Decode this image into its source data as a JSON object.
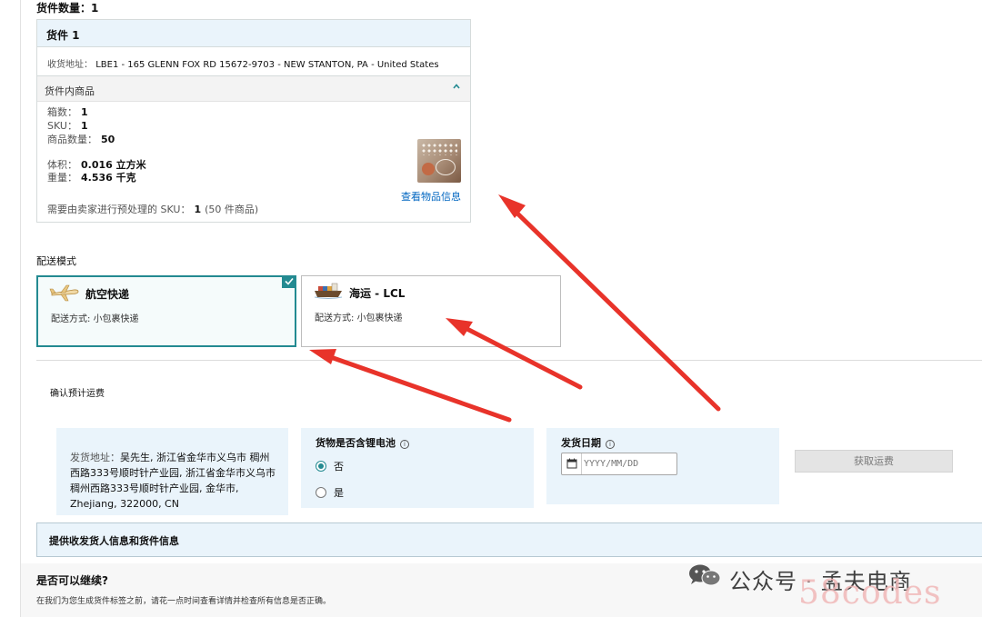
{
  "shipment_count": "货件数量：1",
  "shipment": {
    "title": "货件 1",
    "ship_to_label": "收货地址：",
    "ship_to_value": "LBE1 - 165 GLENN FOX RD 15672-9703 - NEW STANTON, PA - United States",
    "items_header": "货件内商品",
    "boxes_label": "箱数：",
    "boxes_value": "1",
    "sku_label": "SKU：",
    "sku_value": "1",
    "units_label": "商品数量：",
    "units_value": "50",
    "volume_label": "体积：",
    "volume_value": "0.016 立方米",
    "weight_label": "重量：",
    "weight_value": "4.536 千克",
    "view_item_link": "查看物品信息",
    "prep_note_prefix": "需要由卖家进行预处理的 SKU：",
    "prep_note_count": "1",
    "prep_note_suffix": "(50 件商品)"
  },
  "shipping_mode": {
    "title": "配送模式",
    "options": [
      {
        "title": "航空快递",
        "sub_label": "配送方式:",
        "sub_value": "小包裹快递",
        "selected": true
      },
      {
        "title": "海运 - LCL",
        "sub_label": "配送方式:",
        "sub_value": "小包裹快递",
        "selected": false
      }
    ]
  },
  "confirm_fee": {
    "title": "确认预计运费",
    "from_label": "发货地址：",
    "from_value": "吴先生, 浙江省金华市义乌市 稠州西路333号顺时针产业园, 浙江省金华市义乌市 稠州西路333号顺时针产业园, 金华市, Zhejiang, 322000, CN",
    "battery_label": "货物是否含锂电池",
    "battery_options": [
      "否",
      "是"
    ],
    "battery_selected": "否",
    "date_label": "发货日期",
    "date_placeholder": "YYYY/MM/DD",
    "get_fee_button": "获取运费"
  },
  "provide_info_bar": "提供收发货人信息和货件信息",
  "continue_section": {
    "title": "是否可以继续?",
    "description": "在我们为您生成货件标签之前，请花一点时间查看详情并检查所有信息是否正确。"
  },
  "watermark": {
    "account": "公众号 · 孟夫电商",
    "site": "58codes"
  },
  "colors": {
    "accent_teal": "#238a91",
    "panel_blue": "#eaf4fb",
    "link_blue": "#0066c0",
    "arrow_red": "#e8332a"
  }
}
